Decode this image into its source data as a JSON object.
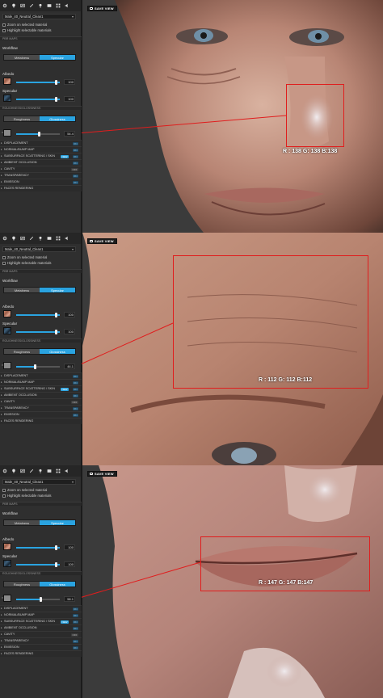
{
  "app": {
    "save_view_label": "SAVE VIEW",
    "material_name": "Male_40_Neutral_Clean1",
    "zoom_option": "Zoom on selected material",
    "highlight_option": "Highlight selectable materials",
    "pbr_maps": "PBR MAPS",
    "workflow_label": "Workflow",
    "workflow_options": [
      "Metalness",
      "Specular"
    ],
    "workflow_selected": "Specular",
    "albedo_label": "Albedo",
    "specular_label": "Specular",
    "roughness_section": "ROUGHNESS/GLOSSINESS",
    "rough_options": [
      "Roughness",
      "Glossiness"
    ],
    "rough_selected": "Glossiness",
    "faces_rendering": "FACES RENDERING",
    "rows": [
      {
        "label": "DISPLACEMENT",
        "state": "ON"
      },
      {
        "label": "NORMAL/BUMP MAP",
        "state": "ON"
      },
      {
        "label": "SUBSURFACE SCATTERING / SKIN",
        "state": "ON",
        "badge": "NEW"
      },
      {
        "label": "AMBIENT OCCLUSION",
        "state": "ON"
      },
      {
        "label": "CAVITY",
        "state": "OFF"
      },
      {
        "label": "TRANSPARENCY",
        "state": "ON"
      },
      {
        "label": "EMISSION",
        "state": "ON"
      }
    ]
  },
  "shots": [
    {
      "subject": "nose",
      "albedo_value": "100",
      "specular_value": "100",
      "gloss_value": "54.4",
      "gloss_fraction": 0.54,
      "rgb_readout": "R : 138 G: 138 B:138"
    },
    {
      "subject": "forehead",
      "albedo_value": "100",
      "specular_value": "100",
      "gloss_value": "44.1",
      "gloss_fraction": 0.44,
      "rgb_readout": "R : 112 G: 112 B:112"
    },
    {
      "subject": "lips",
      "albedo_value": "100",
      "specular_value": "100",
      "gloss_value": "58.1",
      "gloss_fraction": 0.58,
      "rgb_readout": "R : 147 G: 147 B:147"
    }
  ],
  "colors": {
    "accent": "#2aa3e0",
    "highlight_box": "#e01d1d",
    "panel_bg": "#2f2f2f"
  },
  "icons": [
    "gear-icon",
    "bulb-icon",
    "image-icon",
    "wand-icon",
    "pin-icon",
    "film-icon",
    "grid-icon",
    "sound-icon"
  ]
}
